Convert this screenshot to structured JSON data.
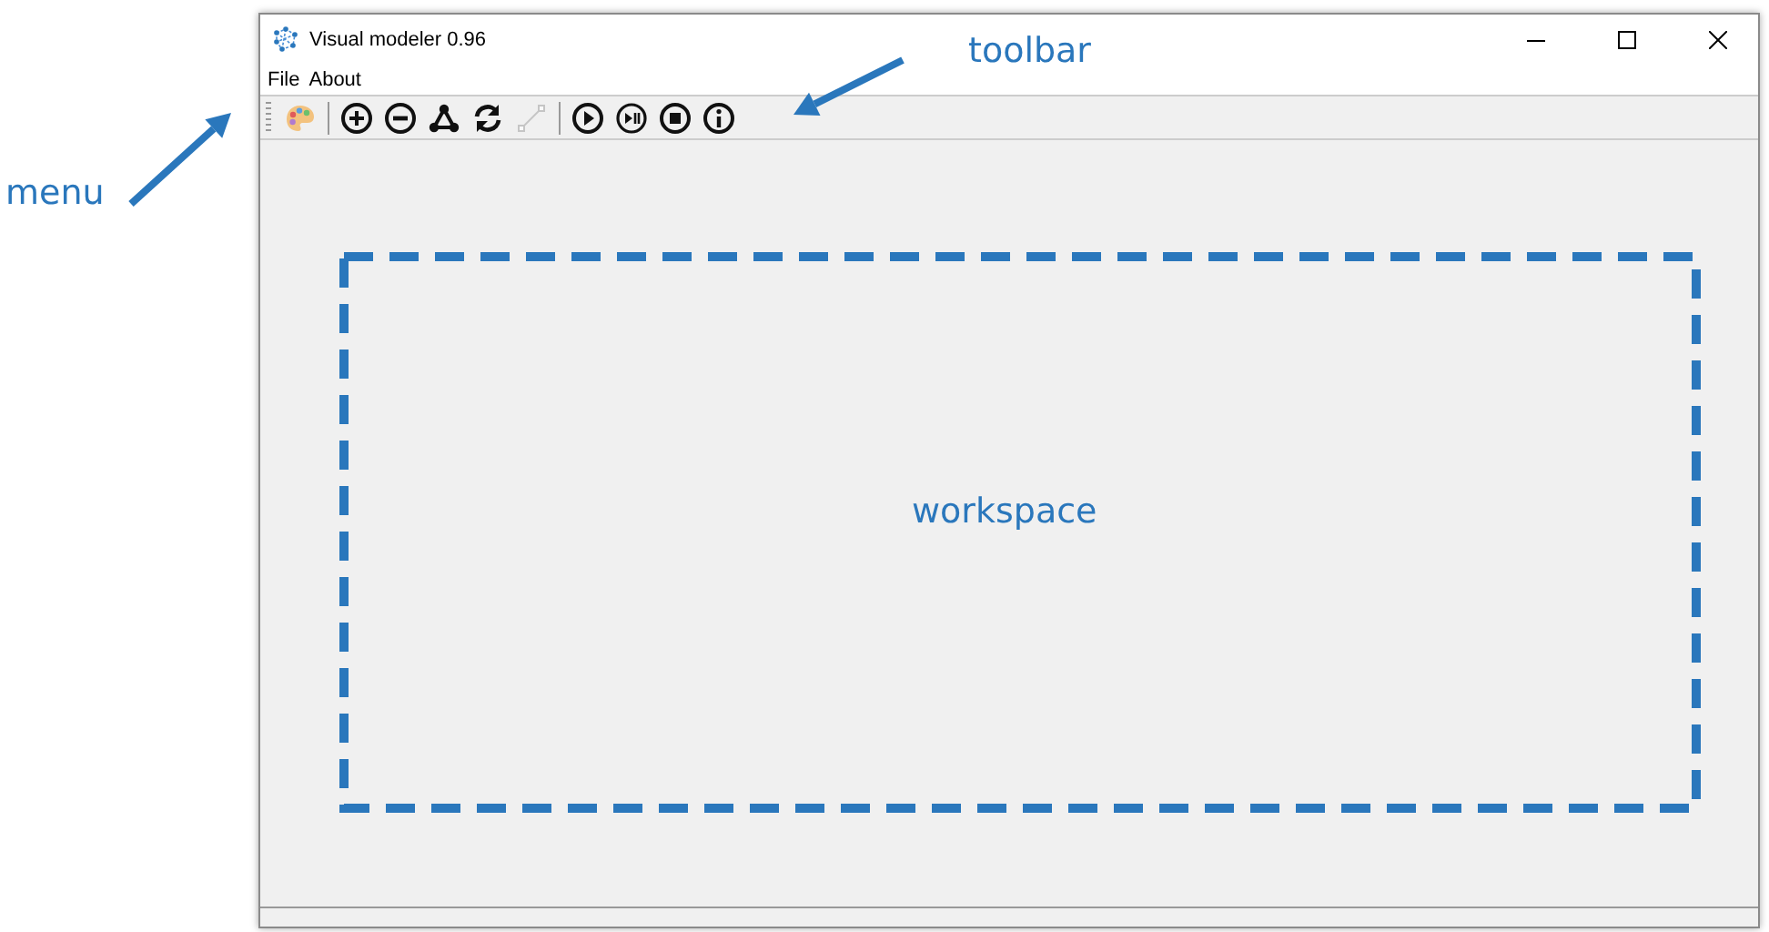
{
  "window": {
    "title": "Visual modeler 0.96"
  },
  "menu": [
    {
      "label": "File"
    },
    {
      "label": "About"
    }
  ],
  "toolbar": [
    {
      "kind": "palette",
      "disabled": false
    },
    {
      "kind": "separator"
    },
    {
      "kind": "zoom-in",
      "disabled": false
    },
    {
      "kind": "zoom-out",
      "disabled": false
    },
    {
      "kind": "graph",
      "disabled": false
    },
    {
      "kind": "refresh",
      "disabled": false
    },
    {
      "kind": "connector",
      "disabled": true
    },
    {
      "kind": "separator"
    },
    {
      "kind": "play",
      "disabled": false
    },
    {
      "kind": "step",
      "disabled": false
    },
    {
      "kind": "stop",
      "disabled": false
    },
    {
      "kind": "info",
      "disabled": false
    }
  ],
  "annotations": [
    {
      "kind": "arrow",
      "label": "menu"
    },
    {
      "kind": "arrow",
      "label": "toolbar"
    },
    {
      "kind": "region",
      "label": "workspace"
    }
  ]
}
